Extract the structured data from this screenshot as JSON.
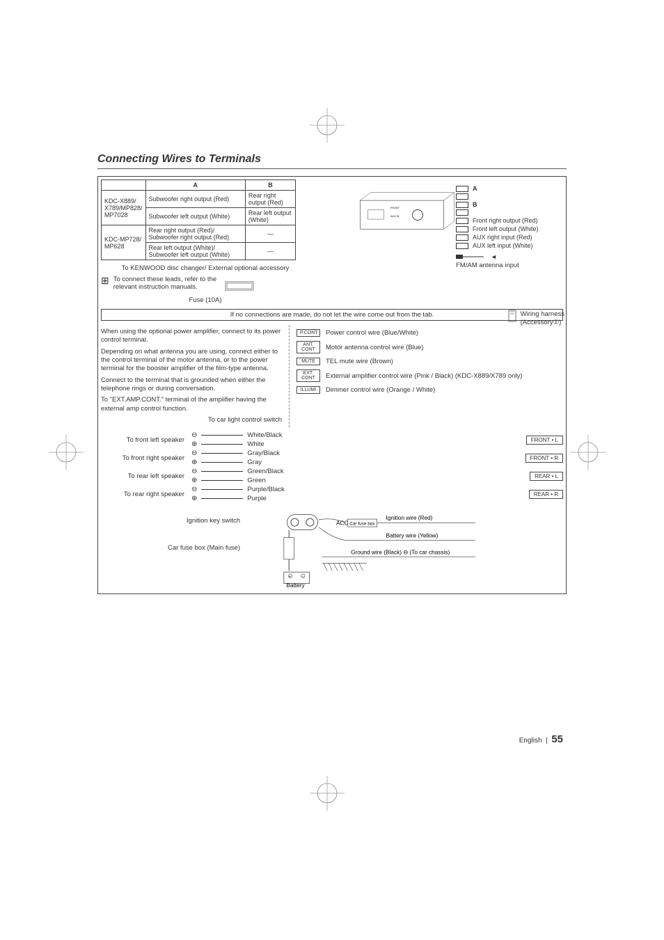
{
  "title": "Connecting Wires to Terminals",
  "table": {
    "head_a": "A",
    "head_b": "B",
    "rows": [
      {
        "model": "KDC-X889/ X789/MP828/ MP7028",
        "a": "Subwoofer right output (Red)",
        "b": "Rear right output (Red)"
      },
      {
        "model": "",
        "a": "Subwoofer left output (White)",
        "b": "Rear left output (White)"
      },
      {
        "model": "KDC-MP728/ MP628",
        "a": "Rear right output (Red)/ Subwoofer right output (Red)",
        "b": "—"
      },
      {
        "model": "",
        "a": "Rear left output (White)/ Subwoofer left output (White)",
        "b": "—"
      }
    ]
  },
  "to_disc_changer": "To KENWOOD disc changer/ External optional accessory",
  "connect_leads": "To connect these leads, refer to the relevant instruction manuals.",
  "fuse": "Fuse (10A)",
  "no_connections_note": "If no connections are made, do not let the wire come out from the tab.",
  "right_outputs": {
    "a": "A",
    "b": "B",
    "front_right": "Front right output (Red)",
    "front_left": "Front left output (White)",
    "aux_right": "AUX right input (Red)",
    "aux_left": "AUX left input (White)",
    "fm_am": "FM/AM antenna input",
    "front_tag": "FRONT",
    "aux_tag": "AUX IN"
  },
  "harness": {
    "label1": "Wiring harness",
    "label2": "(Accessory①)"
  },
  "paragraphs": {
    "p1": "When using the optional power amplifier, connect to its power control terminal.",
    "p2": "Depending on what antenna you are using, connect either to the control terminal of the motor antenna, or to the power terminal for the booster amplifier of the film-type antenna.",
    "p3": "Connect to the terminal that is grounded when either the telephone rings or during conversation.",
    "p4": "To \"EXT.AMP.CONT.\" terminal of the amplifier having the external amp control function.",
    "p5": "To car light control switch"
  },
  "wires": [
    {
      "box": "P.CONT",
      "text": "Power control wire (Blue/White)"
    },
    {
      "box": "ANT. CONT",
      "text": "Motor antenna control wire (Blue)"
    },
    {
      "box": "MUTE",
      "text": "TEL mute wire (Brown)"
    },
    {
      "box": "EXT. CONT",
      "text": "External amplifier control wire (Pink / Black) (KDC-X889/X789 only)"
    },
    {
      "box": "ILLUMI",
      "text": "Dimmer control wire (Orange / White)"
    }
  ],
  "speakers": [
    {
      "dest": "To front left speaker",
      "neg": "White/Black",
      "pos": "White",
      "tag": "FRONT • L"
    },
    {
      "dest": "To front right speaker",
      "neg": "Gray/Black",
      "pos": "Gray",
      "tag": "FRONT • R"
    },
    {
      "dest": "To rear left speaker",
      "neg": "Green/Black",
      "pos": "Green",
      "tag": "REAR • L"
    },
    {
      "dest": "To rear right speaker",
      "neg": "Purple/Black",
      "pos": "Purple",
      "tag": "REAR • R"
    }
  ],
  "ignition": {
    "key": "Ignition key switch",
    "fusebox_main": "Car fuse box (Main fuse)",
    "fusebox": "Car fuse box",
    "acc": "ACC",
    "ign_wire": "Ignition wire (Red)",
    "batt_wire": "Battery wire (Yellow)",
    "gnd_wire": "Ground wire (Black) ⊖ (To car chassis)",
    "battery": "Battery"
  },
  "footer": {
    "lang": "English",
    "sep": "|",
    "page": "55"
  }
}
